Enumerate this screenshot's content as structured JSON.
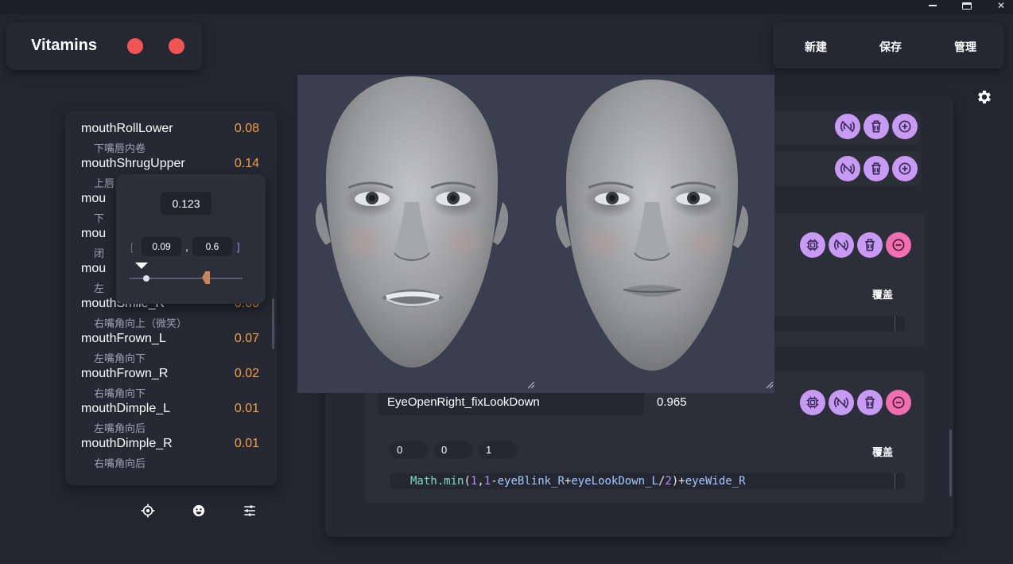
{
  "app": {
    "title": "Vitamins",
    "accent_red": "#f05454",
    "accent_purple": "#c79af4",
    "accent_pink": "#f06fb0",
    "value_orange": "#f0a04b"
  },
  "window_controls": {
    "minimize_icon": "minimize-icon",
    "maximize_icon": "maximize-icon",
    "close_icon": "close-icon",
    "close_glyph": "✕"
  },
  "menu": {
    "new_label": "新建",
    "save_label": "保存",
    "manage_label": "管理"
  },
  "blendshape_list": [
    {
      "name": "mouthRollLower",
      "value": "0.08",
      "desc": "下嘴唇内卷"
    },
    {
      "name": "mouthShrugUpper",
      "value": "0.14",
      "desc": "上唇"
    },
    {
      "name": "mou",
      "value": "",
      "desc": "下"
    },
    {
      "name": "mou",
      "value": "",
      "desc": "闭"
    },
    {
      "name": "mou",
      "value": "",
      "desc": "左"
    },
    {
      "name": "mouthSmile_R",
      "value": "0.00",
      "desc": "右嘴角向上（微笑）"
    },
    {
      "name": "mouthFrown_L",
      "value": "0.07",
      "desc": "左嘴角向下"
    },
    {
      "name": "mouthFrown_R",
      "value": "0.02",
      "desc": "右嘴角向下"
    },
    {
      "name": "mouthDimple_L",
      "value": "0.01",
      "desc": "左嘴角向后"
    },
    {
      "name": "mouthDimple_R",
      "value": "0.01",
      "desc": "右嘴角向后"
    }
  ],
  "range_popup": {
    "current": "0.123",
    "min": "0.09",
    "max": "0.6",
    "open_bracket": "[",
    "close_bracket": "]",
    "separator": ",",
    "slider_low_fraction": 0.09,
    "slider_high_fraction": 0.6
  },
  "cards": [
    {
      "cover_label": "覆盖"
    },
    {
      "cover_label": "覆盖",
      "expression_name": "EyeOpenRight_fixLookDown",
      "expression_value": "0.965",
      "params": [
        "0",
        "0",
        "1"
      ],
      "code": {
        "fn": "Math.min",
        "open": "(",
        "n1": "1",
        "c1": ",",
        "n2": "1",
        "minus": "-",
        "v1": "eyeBlink_R",
        "plus1": "+",
        "v2": "eyeLookDown_L",
        "div": "/",
        "n3": "2",
        "close": ")",
        "plus2": "+",
        "v3": "eyeWide_R"
      }
    }
  ],
  "icons": {
    "settings": "gear-icon",
    "locate": "crosshair-icon",
    "face": "smiley-icon",
    "sliders": "sliders-icon",
    "chip": "chip-icon",
    "signal": "signal-icon",
    "delete": "trash-icon",
    "add": "plus-circle-icon",
    "remove": "minus-circle-icon"
  }
}
